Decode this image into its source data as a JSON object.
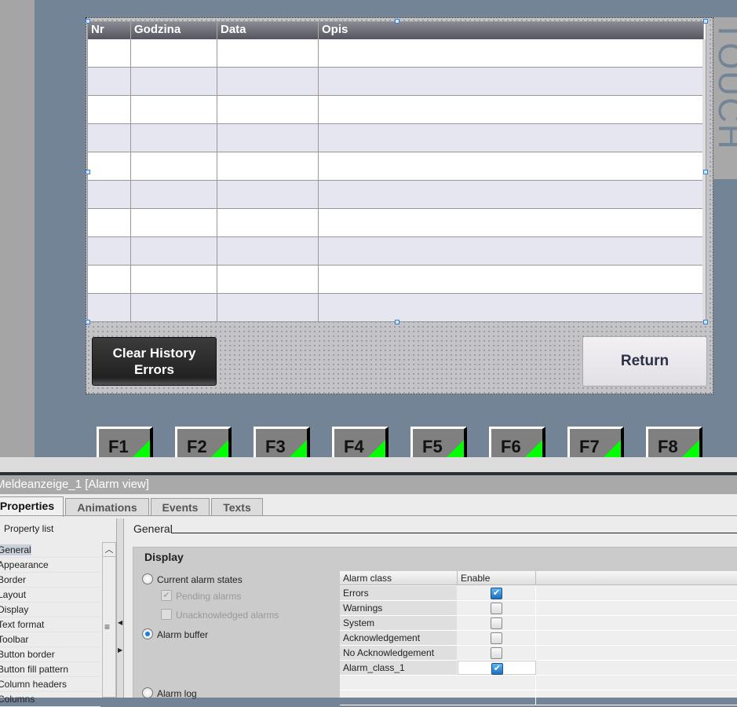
{
  "hmi": {
    "side_label": "TOUCH",
    "table": {
      "columns": [
        "Nr",
        "Godzina",
        "Data",
        "Opis"
      ],
      "row_count": 10
    },
    "clear_button": {
      "line1": "Clear History",
      "line2": "Errors"
    },
    "return_button": "Return",
    "function_keys": [
      "F1",
      "F2",
      "F3",
      "F4",
      "F5",
      "F6",
      "F7",
      "F8"
    ]
  },
  "inspector": {
    "title": "Meldeanzeige_1 [Alarm view]",
    "tabs": [
      "Properties",
      "Animations",
      "Events",
      "Texts"
    ],
    "property_list_label": "Property list",
    "property_items": [
      "General",
      "Appearance",
      "Border",
      "Layout",
      "Display",
      "Text format",
      "Toolbar",
      "Button border",
      "Button fill pattern",
      "Column headers",
      "Columns"
    ],
    "section_title": "General",
    "display": {
      "title": "Display",
      "current_alarm_states": "Current alarm states",
      "pending_alarms": "Pending alarms",
      "unacknowledged_alarms": "Unacknowledged alarms",
      "alarm_buffer": "Alarm buffer",
      "alarm_log": "Alarm log",
      "selected": "Alarm buffer"
    },
    "alarm_classes": {
      "headers": [
        "Alarm class",
        "Enable"
      ],
      "rows": [
        {
          "name": "Errors",
          "enabled": true
        },
        {
          "name": "Warnings",
          "enabled": false
        },
        {
          "name": "System",
          "enabled": false
        },
        {
          "name": "Acknowledgement",
          "enabled": false
        },
        {
          "name": "No Acknowledgement",
          "enabled": false
        },
        {
          "name": "Alarm_class_1",
          "enabled": true
        }
      ]
    }
  }
}
